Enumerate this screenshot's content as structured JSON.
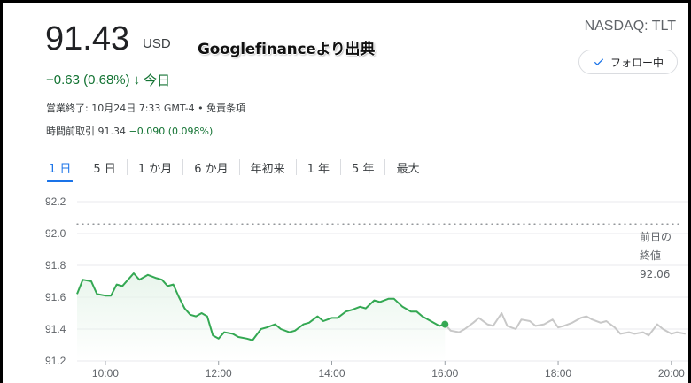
{
  "quote": {
    "price": "91.43",
    "currency": "USD",
    "change": "−0.63 (0.68%)",
    "change_arrow": "↓",
    "change_period": "今日",
    "ticker": "NASDAQ: TLT",
    "status_line": "営業終了: 10月24日 7:33 GMT-4 • 免責条項",
    "premarket_label": "時間前取引",
    "premarket_price": "91.34",
    "premarket_change": "−0.090 (0.098%)"
  },
  "watermark": "Googlefinanceより出典",
  "follow_button": {
    "label": "フォロー中",
    "icon": "check-icon"
  },
  "tabs": [
    {
      "label": "1 日",
      "active": true
    },
    {
      "label": "5 日",
      "active": false
    },
    {
      "label": "1 か月",
      "active": false
    },
    {
      "label": "6 か月",
      "active": false
    },
    {
      "label": "年初来",
      "active": false
    },
    {
      "label": "1 年",
      "active": false
    },
    {
      "label": "5 年",
      "active": false
    },
    {
      "label": "最大",
      "active": false
    }
  ],
  "colors": {
    "up_line": "#34a853",
    "after_hours_line": "#c8c8c8",
    "accent": "#1a73e8",
    "down_text": "#137333"
  },
  "chart_data": {
    "type": "line",
    "y_ticks": [
      "92.2",
      "92.0",
      "91.8",
      "91.6",
      "91.4",
      "91.2"
    ],
    "x_ticks": [
      "10:00",
      "12:00",
      "14:00",
      "16:00",
      "18:00",
      "20:00"
    ],
    "ylim": [
      91.2,
      92.2
    ],
    "xlim": [
      9.5,
      20.3
    ],
    "previous_close": {
      "label_line1": "前日の",
      "label_line2": "終値",
      "value": "92.06",
      "y": 92.06
    },
    "series": [
      {
        "session": "regular",
        "x": [
          9.5,
          9.6,
          9.75,
          9.85,
          10.0,
          10.1,
          10.2,
          10.3,
          10.4,
          10.5,
          10.6,
          10.75,
          10.9,
          11.0,
          11.1,
          11.2,
          11.3,
          11.4,
          11.5,
          11.6,
          11.7,
          11.8,
          11.9,
          12.0,
          12.1,
          12.25,
          12.35,
          12.5,
          12.6,
          12.75,
          12.85,
          13.0,
          13.1,
          13.25,
          13.35,
          13.5,
          13.6,
          13.75,
          13.85,
          14.0,
          14.1,
          14.25,
          14.35,
          14.5,
          14.6,
          14.75,
          14.85,
          15.0,
          15.1,
          15.25,
          15.4,
          15.5,
          15.6,
          15.75,
          15.9,
          16.0
        ],
        "y": [
          91.62,
          91.71,
          91.7,
          91.62,
          91.61,
          91.61,
          91.68,
          91.67,
          91.71,
          91.75,
          91.71,
          91.74,
          91.72,
          91.71,
          91.67,
          91.68,
          91.6,
          91.53,
          91.49,
          91.48,
          91.5,
          91.48,
          91.36,
          91.34,
          91.38,
          91.37,
          91.35,
          91.34,
          91.33,
          91.4,
          91.41,
          91.43,
          91.4,
          91.38,
          91.39,
          91.43,
          91.44,
          91.48,
          91.45,
          91.47,
          91.47,
          91.51,
          91.52,
          91.54,
          91.53,
          91.58,
          91.57,
          91.59,
          91.59,
          91.54,
          91.51,
          91.51,
          91.48,
          91.45,
          91.42,
          91.43
        ]
      },
      {
        "session": "after_hours",
        "x": [
          16.0,
          16.1,
          16.25,
          16.35,
          16.5,
          16.6,
          16.75,
          16.85,
          17.0,
          17.1,
          17.25,
          17.35,
          17.5,
          17.6,
          17.75,
          17.9,
          18.0,
          18.1,
          18.25,
          18.4,
          18.5,
          18.6,
          18.75,
          18.85,
          19.0,
          19.1,
          19.25,
          19.35,
          19.5,
          19.6,
          19.75,
          19.85,
          20.0,
          20.1,
          20.25
        ],
        "y": [
          91.43,
          91.39,
          91.38,
          91.4,
          91.44,
          91.47,
          91.43,
          91.42,
          91.5,
          91.42,
          91.4,
          91.46,
          91.45,
          91.42,
          91.43,
          91.46,
          91.41,
          91.42,
          91.44,
          91.47,
          91.48,
          91.46,
          91.44,
          91.45,
          91.41,
          91.37,
          91.38,
          91.37,
          91.38,
          91.36,
          91.43,
          91.4,
          91.37,
          91.38,
          91.37
        ]
      }
    ],
    "marker": {
      "x": 16.0,
      "y": 91.43
    }
  }
}
